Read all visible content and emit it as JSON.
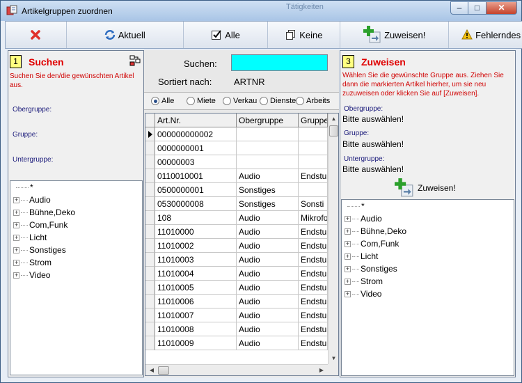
{
  "window": {
    "title": "Artikelgruppen zuordnen",
    "background_text": "Tätigkeiten",
    "minimize_glyph": "–",
    "maximize_glyph": "□",
    "close_glyph": "✕"
  },
  "toolbar": {
    "close_icon": "red-x-icon",
    "aktuell_label": "Aktuell",
    "alle_label": "Alle",
    "keine_label": "Keine",
    "zuweisen_label": "Zuweisen!",
    "fehler_label": "Fehlerndes"
  },
  "left_panel": {
    "step": "1",
    "title": "Suchen",
    "instruction": "Suchen Sie den/die gewünschten Artikel aus.",
    "obergruppe_label": "Obergruppe:",
    "gruppe_label": "Gruppe:",
    "untergruppe_label": "Untergruppe:",
    "tree_items": [
      "*",
      "Audio",
      "Bühne,Deko",
      "Com,Funk",
      "Licht",
      "Sonstiges",
      "Strom",
      "Video"
    ]
  },
  "middle_panel": {
    "search_label": "Suchen:",
    "search_value": "",
    "sort_label": "Sortiert nach:",
    "sort_value": "ARTNR",
    "radios": [
      {
        "label": "Alle",
        "checked": true
      },
      {
        "label": "Miete",
        "checked": false
      },
      {
        "label": "Verkau",
        "checked": false
      },
      {
        "label": "Dienste",
        "checked": false
      },
      {
        "label": "Arbeits",
        "checked": false
      }
    ],
    "columns": [
      "Art.Nr.",
      "Obergruppe",
      "Gruppe"
    ],
    "rows": [
      [
        "000000000002",
        "",
        ""
      ],
      [
        "0000000001",
        "",
        ""
      ],
      [
        "00000003",
        "",
        ""
      ],
      [
        "0110010001",
        "Audio",
        "Endstu"
      ],
      [
        "0500000001",
        "Sonstiges",
        ""
      ],
      [
        "0530000008",
        "Sonstiges",
        "Sonsti"
      ],
      [
        "108",
        "Audio",
        "Mikrofo"
      ],
      [
        "11010000",
        "Audio",
        "Endstu"
      ],
      [
        "11010002",
        "Audio",
        "Endstu"
      ],
      [
        "11010003",
        "Audio",
        "Endstu"
      ],
      [
        "11010004",
        "Audio",
        "Endstu"
      ],
      [
        "11010005",
        "Audio",
        "Endstu"
      ],
      [
        "11010006",
        "Audio",
        "Endstu"
      ],
      [
        "11010007",
        "Audio",
        "Endstu"
      ],
      [
        "11010008",
        "Audio",
        "Endstu"
      ],
      [
        "11010009",
        "Audio",
        "Endstu"
      ]
    ]
  },
  "right_panel": {
    "step": "3",
    "title": "Zuweisen",
    "instruction": "Wählen Sie die gewünschte Gruppe aus. Ziehen Sie dann die markierten Artikel hierher, um sie neu zuzuweisen oder klicken Sie auf [Zuweisen].",
    "obergruppe_label": "Obergruppe:",
    "obergruppe_value": "Bitte auswählen!",
    "gruppe_label": "Gruppe:",
    "gruppe_value": "Bitte auswählen!",
    "untergruppe_label": "Untergruppe:",
    "untergruppe_value": "Bitte auswählen!",
    "assign_label": "Zuweisen!",
    "tree_items": [
      "*",
      "Audio",
      "Bühne,Deko",
      "Com,Funk",
      "Licht",
      "Sonstiges",
      "Strom",
      "Video"
    ]
  }
}
